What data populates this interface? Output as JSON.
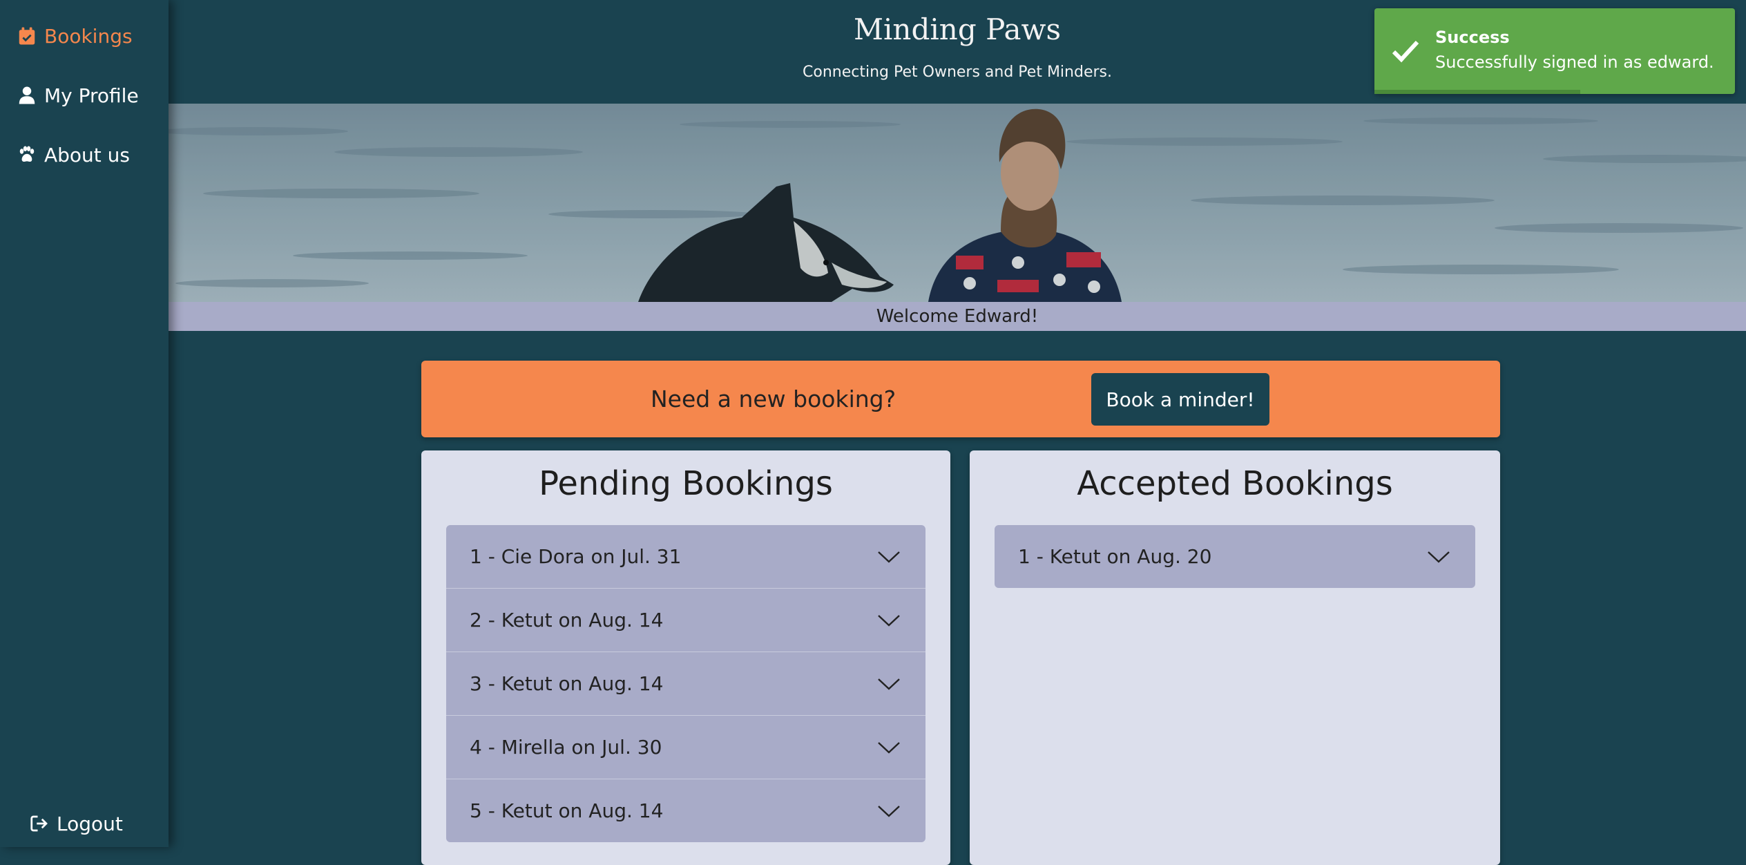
{
  "sidebar": {
    "items": [
      {
        "label": "Bookings",
        "icon": "calendar-check-icon",
        "active": true
      },
      {
        "label": "My Profile",
        "icon": "user-icon",
        "active": false
      },
      {
        "label": "About us",
        "icon": "paw-icon",
        "active": false
      }
    ],
    "logout": {
      "label": "Logout",
      "icon": "sign-out-icon"
    }
  },
  "header": {
    "title": "Minding Paws",
    "subtitle": "Connecting Pet Owners and Pet Minders."
  },
  "welcome": "Welcome Edward!",
  "banner": {
    "text": "Need a new booking?",
    "button_label": "Book a minder!"
  },
  "pending": {
    "title": "Pending Bookings",
    "items": [
      {
        "label": "1 - Cie Dora on Jul. 31"
      },
      {
        "label": "2 - Ketut on Aug. 14"
      },
      {
        "label": "3 - Ketut on Aug. 14"
      },
      {
        "label": "4 - Mirella on Jul. 30"
      },
      {
        "label": "5 - Ketut on Aug. 14"
      }
    ]
  },
  "accepted": {
    "title": "Accepted Bookings",
    "items": [
      {
        "label": "1 - Ketut on Aug. 20"
      }
    ]
  },
  "toast": {
    "title": "Success",
    "message": "Successfully signed in as edward.",
    "progress": 0.57
  },
  "colors": {
    "background": "#1a4350",
    "accent": "#f5874d",
    "panel": "#dcdfec",
    "item": "#a8abc8",
    "success": "#5fa84a"
  }
}
